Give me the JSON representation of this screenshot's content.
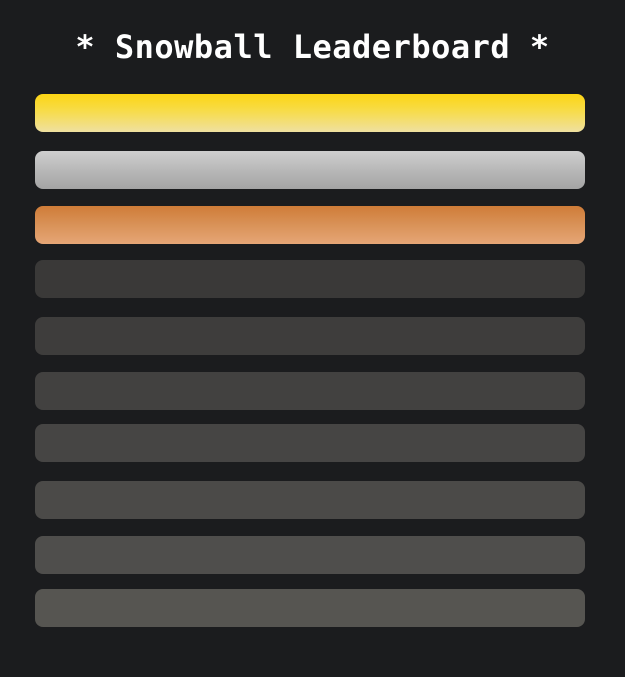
{
  "leaderboard": {
    "title": "* Snowball Leaderboard *",
    "rows": [
      {
        "rank_style": "gold",
        "color": "#fdd514"
      },
      {
        "rank_style": "silver",
        "color": "#bdbdbd"
      },
      {
        "rank_style": "bronze",
        "color": "#d4864a"
      },
      {
        "rank_style": "plain",
        "color": "#3a3938"
      },
      {
        "rank_style": "plain",
        "color": "#3e3d3c"
      },
      {
        "rank_style": "plain",
        "color": "#424140"
      },
      {
        "rank_style": "plain",
        "color": "#464544"
      },
      {
        "rank_style": "plain",
        "color": "#4b4a48"
      },
      {
        "rank_style": "plain",
        "color": "#4f4e4c"
      },
      {
        "rank_style": "plain",
        "color": "#565551"
      }
    ]
  }
}
